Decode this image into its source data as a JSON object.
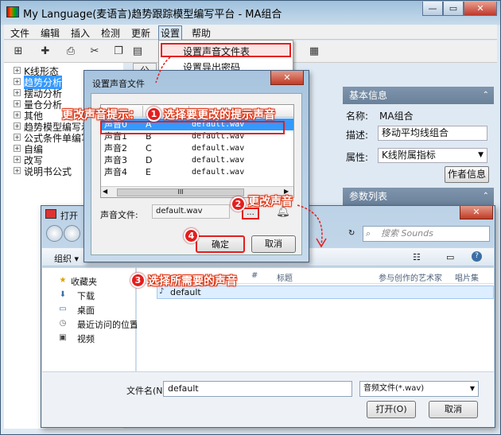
{
  "main": {
    "title": "My Language(麦语言)趋势跟踪模型编写平台 - MA组合",
    "window_buttons": [
      "—",
      "▭",
      "✕"
    ],
    "menu": [
      "文件",
      "编辑",
      "插入",
      "检测",
      "更新",
      "设置",
      "帮助"
    ],
    "toolbar_icons": [
      "add-icon",
      "new-file-icon",
      "save-icon",
      "print-icon",
      "cut-icon",
      "copy-icon",
      "paste-icon",
      "undo-icon",
      "redo-icon",
      "find-icon",
      "check-icon",
      "document-icon"
    ]
  },
  "dropdown": {
    "items": [
      "设置声音文件表",
      "设置导出密码"
    ]
  },
  "tree": {
    "items": [
      "K线形态",
      "趋势分析",
      "摆动分析",
      "量仓分析",
      "其他",
      "趋势模型编写示",
      "公式条件单编写",
      "自编",
      "改写",
      "说明书公式"
    ],
    "selected_index": 1
  },
  "right_panel": {
    "tab_label": "公",
    "basic_info_header": "基本信息",
    "name_label": "名称:",
    "name_value": "MA组合",
    "desc_label": "描述:",
    "desc_value": "移动平均线组合",
    "attr_label": "属性:",
    "attr_value": "K线附属指标",
    "author_button": "作者信息",
    "params_header": "参数列表"
  },
  "sound_dialog": {
    "title": "设置声音文件",
    "close": "✕",
    "rows": [
      {
        "name": "声音0",
        "key": "A",
        "file": "default.wav"
      },
      {
        "name": "声音1",
        "key": "B",
        "file": "default.wav"
      },
      {
        "name": "声音2",
        "key": "C",
        "file": "default.wav"
      },
      {
        "name": "声音3",
        "key": "D",
        "file": "default.wav"
      },
      {
        "name": "声音4",
        "key": "E",
        "file": "default.wav"
      }
    ],
    "scroll_grip": "III",
    "file_label": "声音文件:",
    "file_value": "default.wav",
    "browse_label": "...",
    "ok_label": "确定",
    "cancel_label": "取消"
  },
  "open_dialog": {
    "title": "打开",
    "close": "✕",
    "search_placeholder": "搜索 Sounds",
    "organize_label": "组织 ▾",
    "sidebar": [
      {
        "icon": "star-icon",
        "label": "收藏夹"
      },
      {
        "icon": "download-icon",
        "label": "下载"
      },
      {
        "icon": "desktop-icon",
        "label": "桌面"
      },
      {
        "icon": "recent-icon",
        "label": "最近访问的位置"
      },
      {
        "icon": "video-icon",
        "label": "视频"
      }
    ],
    "columns": [
      "#",
      "标题",
      "参与创作的艺术家",
      "唱片集"
    ],
    "file": "default",
    "filename_label": "文件名(N):",
    "filename_value": "default",
    "filetype_value": "音频文件(*.wav)",
    "open_label": "打开(O)",
    "cancel_label": "取消"
  },
  "annotations": {
    "label_change_prompt": "更改声音提示：",
    "step1": {
      "num": "1",
      "text": "选择要更改的提示声音"
    },
    "step2": {
      "num": "2",
      "text": "更改声音"
    },
    "step3": {
      "num": "3",
      "text": "选择所需要的声音"
    },
    "step4": {
      "num": "4"
    }
  },
  "colors": {
    "annotation_red": "#e41e1e",
    "selection_blue": "#3399ff",
    "tree_selection": "#3399ff"
  }
}
